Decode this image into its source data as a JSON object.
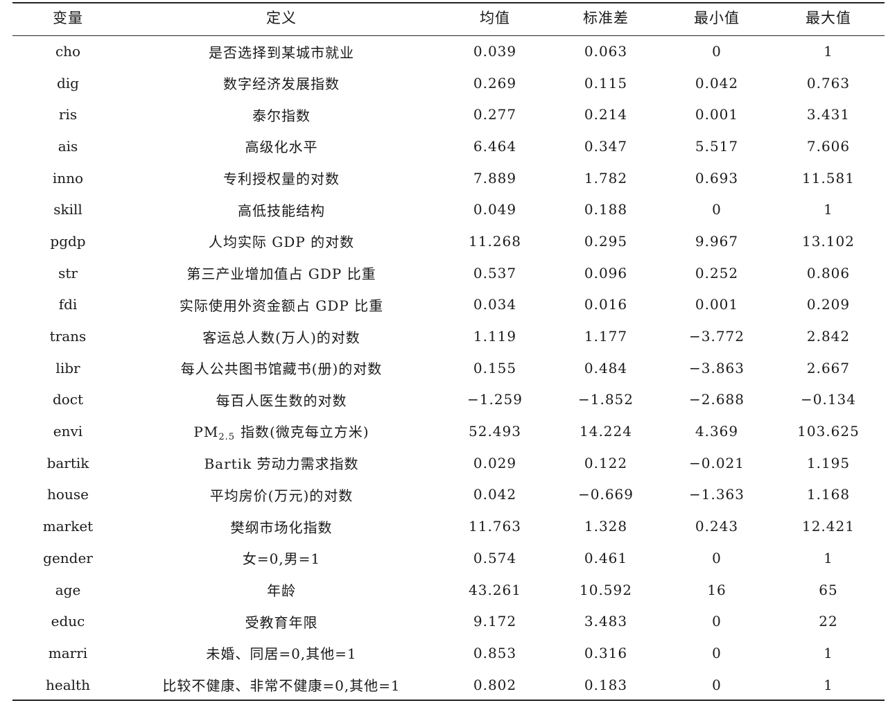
{
  "table": {
    "headers": [
      "变量",
      "定义",
      "均值",
      "标准差",
      "最小值",
      "最大值"
    ],
    "rows": [
      [
        "cho",
        "是否选择到某城市就业",
        "0.039",
        "0.063",
        "0",
        "1"
      ],
      [
        "dig",
        "数字经济发展指数",
        "0.269",
        "0.115",
        "0.042",
        "0.763"
      ],
      [
        "ris",
        "泰尔指数",
        "0.277",
        "0.214",
        "0.001",
        "3.431"
      ],
      [
        "ais",
        "高级化水平",
        "6.464",
        "0.347",
        "5.517",
        "7.606"
      ],
      [
        "inno",
        "专利授权量的对数",
        "7.889",
        "1.782",
        "0.693",
        "11.581"
      ],
      [
        "skill",
        "高低技能结构",
        "0.049",
        "0.188",
        "0",
        "1"
      ],
      [
        "pgdp",
        "人均实际 GDP 的对数",
        "11.268",
        "0.295",
        "9.967",
        "13.102"
      ],
      [
        "str",
        "第三产业增加值占 GDP 比重",
        "0.537",
        "0.096",
        "0.252",
        "0.806"
      ],
      [
        "fdi",
        "实际使用外资金额占 GDP 比重",
        "0.034",
        "0.016",
        "0.001",
        "0.209"
      ],
      [
        "trans",
        "客运总人数(万人)的对数",
        "1.119",
        "1.177",
        "−3.772",
        "2.842"
      ],
      [
        "libr",
        "每人公共图书馆藏书(册)的对数",
        "0.155",
        "0.484",
        "−3.863",
        "2.667"
      ],
      [
        "doct",
        "每百人医生数的对数",
        "−1.259",
        "−1.852",
        "−2.688",
        "−0.134"
      ],
      [
        "envi",
        "指数(微克每立方米)",
        "52.493",
        "14.224",
        "4.369",
        "103.625"
      ],
      [
        "bartik",
        "Bartik 劳动力需求指数",
        "0.029",
        "0.122",
        "−0.021",
        "1.195"
      ],
      [
        "house",
        "平均房价(万元)的对数",
        "0.042",
        "−0.669",
        "−1.363",
        "1.168"
      ],
      [
        "market",
        "樊纲市场化指数",
        "11.763",
        "1.328",
        "0.243",
        "12.421"
      ],
      [
        "gender",
        "女=0,男=1",
        "0.574",
        "0.461",
        "0",
        "1"
      ],
      [
        "age",
        "年龄",
        "43.261",
        "10.592",
        "16",
        "65"
      ],
      [
        "educ",
        "受教育年限",
        "9.172",
        "3.483",
        "0",
        "22"
      ],
      [
        "marri",
        "未婚、同居=0,其他=1",
        "0.853",
        "0.316",
        "0",
        "1"
      ],
      [
        "health",
        "比较不健康、非常不健康=0,其他=1",
        "0.802",
        "0.183",
        "0",
        "1"
      ]
    ],
    "pm_label": "PM",
    "pm_sub": "2.5"
  }
}
